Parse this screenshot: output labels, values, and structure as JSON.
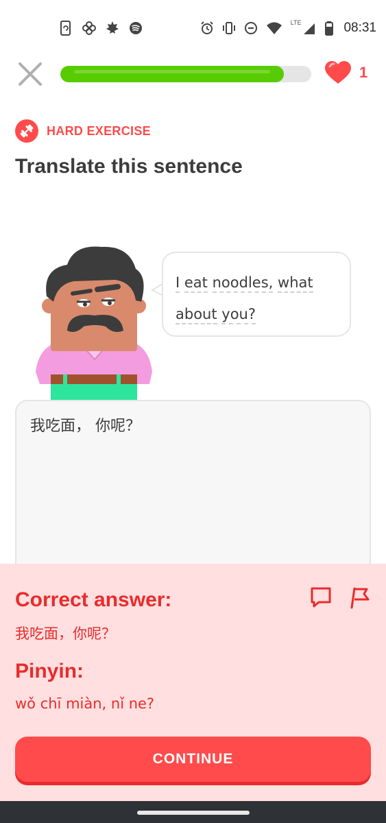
{
  "status_bar": {
    "left_icons": [
      "phone-sync-icon",
      "pinwheel-icon",
      "maple-leaf-icon",
      "spotify-icon"
    ],
    "right_icons": [
      "alarm-icon",
      "vibrate-icon",
      "do-not-disturb-icon",
      "wifi-icon",
      "signal-icon",
      "battery-icon"
    ],
    "network": "LTE",
    "time": "08:31"
  },
  "header": {
    "progress_fraction": 0.89,
    "hearts": "1"
  },
  "exercise": {
    "badge_label": "HARD EXERCISE",
    "title": "Translate this sentence",
    "bubble_words": [
      "I",
      "eat",
      "noodles,",
      "what",
      "about",
      "you?"
    ]
  },
  "answer": {
    "value": "我吃面， 你呢？"
  },
  "feedback": {
    "correct_heading": "Correct answer:",
    "correct_text": "我吃面，你呢？",
    "pinyin_heading": "Pinyin:",
    "pinyin_text": "wǒ chī miàn, nǐ ne?",
    "continue_label": "CONTINUE"
  },
  "colors": {
    "accent_red": "#ff4b4b",
    "feedback_text": "#ea2b2b",
    "feedback_bg": "#ffdfe0",
    "progress_green": "#58cc02"
  }
}
